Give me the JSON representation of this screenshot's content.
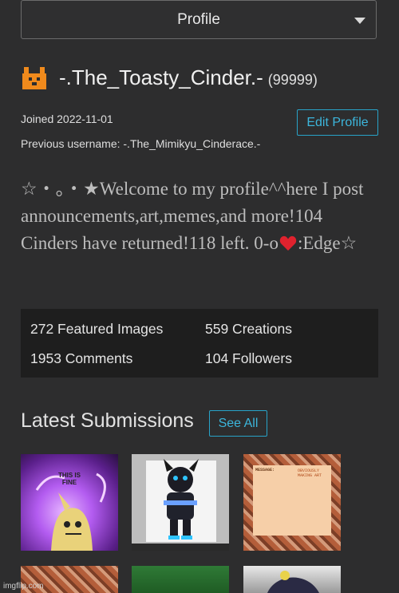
{
  "header": {
    "dropdown_label": "Profile"
  },
  "user": {
    "name": "-.The_Toasty_Cinder.-",
    "points": "(99999)",
    "joined": "Joined 2022-11-01",
    "previous_username": "Previous username: -.The_Mimikyu_Cinderace.-",
    "edit_label": "Edit Profile"
  },
  "bio": {
    "before_heart": "☆・。・★Welcome to my profile^^here I post announcements,art,memes,and more!104 Cinders have returned!118 left. 0-o",
    "after_heart": ":Edge☆"
  },
  "stats": {
    "featured": "272 Featured Images",
    "creations": "559 Creations",
    "comments": "1953 Comments",
    "followers": "104 Followers"
  },
  "submissions": {
    "title": "Latest Submissions",
    "see_all": "See All",
    "thumb1_caption": "THIS IS FINE",
    "thumb3_note_title": "MESSAGE:",
    "thumb3_note_tag": "OBVIOUSLY MAKING ART"
  },
  "footer": {
    "watermark": "imgflip.com"
  },
  "colors": {
    "accent": "#28a3c8",
    "background": "#2d2d2e",
    "stats_bg": "#1e1e1e"
  }
}
